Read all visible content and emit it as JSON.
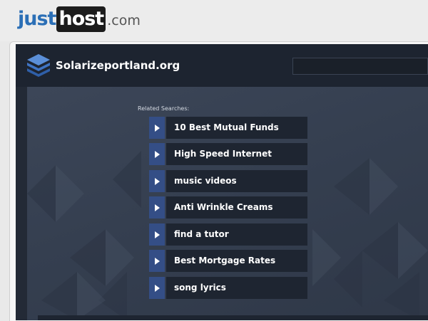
{
  "brand": {
    "just": "just",
    "host": "host",
    "tld": ".com"
  },
  "site": {
    "title": "Solarizeportland.org",
    "search_placeholder": ""
  },
  "related": {
    "label": "Related Searches:",
    "items": [
      "10 Best Mutual Funds",
      "High Speed Internet",
      "music videos",
      "Anti Wrinkle Creams",
      "find a tutor",
      "Best Mortgage Rates",
      "song lyrics"
    ]
  },
  "icons": {
    "site_logo": "layers-stack-icon",
    "item_arrow": "play-arrow-icon"
  },
  "colors": {
    "brand_blue": "#2b6fb6",
    "site_bg": "#232a36",
    "arrow_box": "#344e86"
  }
}
